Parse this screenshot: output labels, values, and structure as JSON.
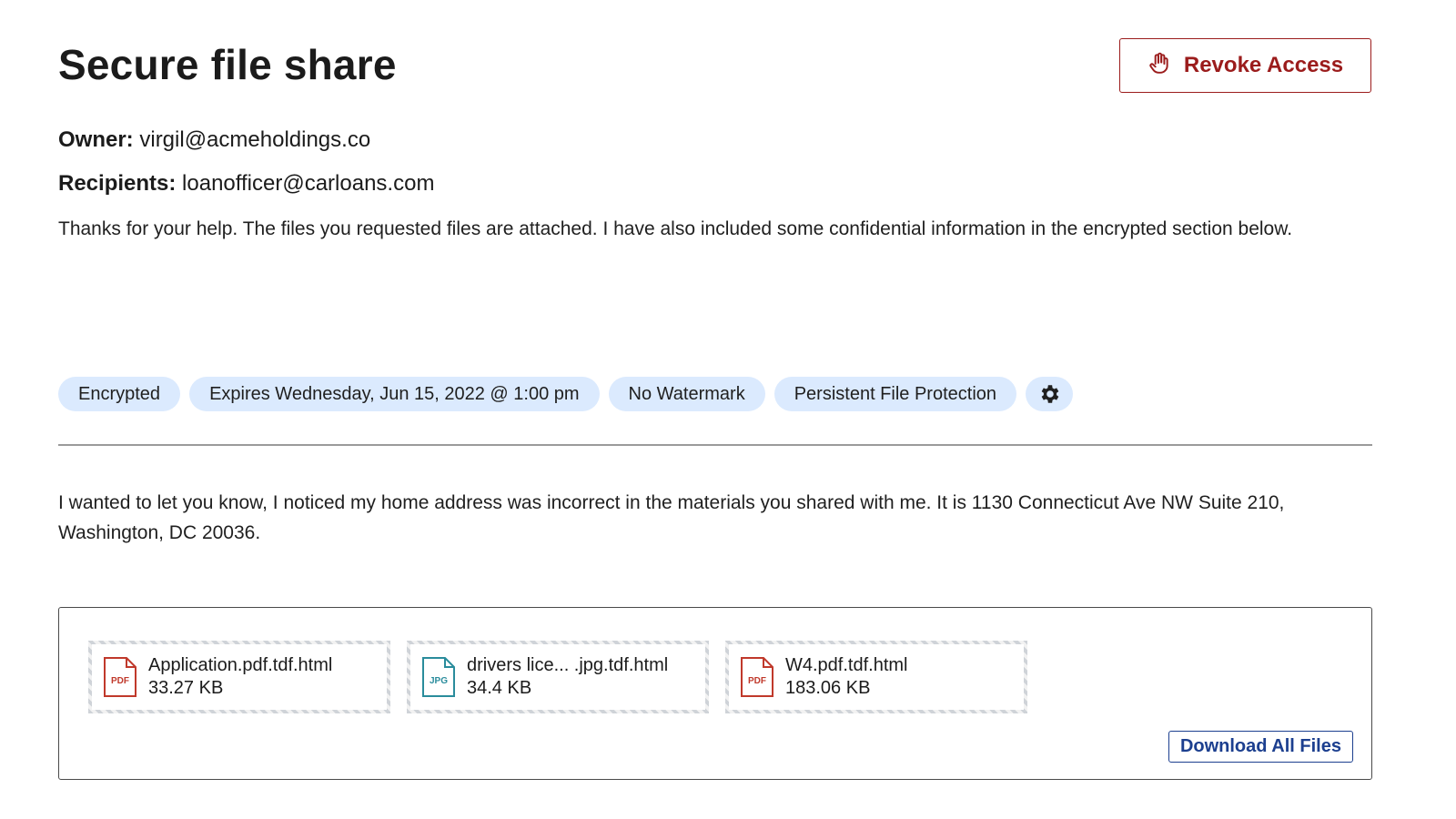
{
  "page": {
    "title": "Secure file share"
  },
  "header": {
    "revoke_label": "Revoke Access",
    "revoke_icon": "hand-stop-icon"
  },
  "meta": {
    "owner_label": "Owner:",
    "owner_value": "virgil@acmeholdings.co",
    "recipients_label": "Recipients:",
    "recipients_value": "loanofficer@carloans.com"
  },
  "message_public": "Thanks for your help. The files you requested files are attached. I have also included some confidential information in the encrypted section below.",
  "tags": [
    {
      "label": "Encrypted"
    },
    {
      "label": "Expires Wednesday, Jun 15, 2022 @ 1:00 pm"
    },
    {
      "label": "No Watermark"
    },
    {
      "label": "Persistent File Protection"
    }
  ],
  "settings_icon": "gear-icon",
  "message_encrypted": "I wanted to let you know, I noticed my home address was incorrect in the materials you shared with me. It is 1130 Connecticut Ave NW Suite 210, Washington, DC 20036.",
  "files": [
    {
      "name": "Application.pdf.tdf.html",
      "size": "33.27 KB",
      "type": "PDF",
      "icon": "pdf-file-icon"
    },
    {
      "name": "drivers lice...  .jpg.tdf.html",
      "size": "34.4 KB",
      "type": "JPG",
      "icon": "jpg-file-icon"
    },
    {
      "name": "W4.pdf.tdf.html",
      "size": "183.06 KB",
      "type": "PDF",
      "icon": "pdf-file-icon"
    }
  ],
  "download_all_label": "Download All Files",
  "colors": {
    "danger": "#9b1c1c",
    "primary": "#1c3f8f",
    "tag_bg": "#dbeafe",
    "pdf_red": "#c0392b",
    "jpg_teal": "#2a8c9c"
  }
}
